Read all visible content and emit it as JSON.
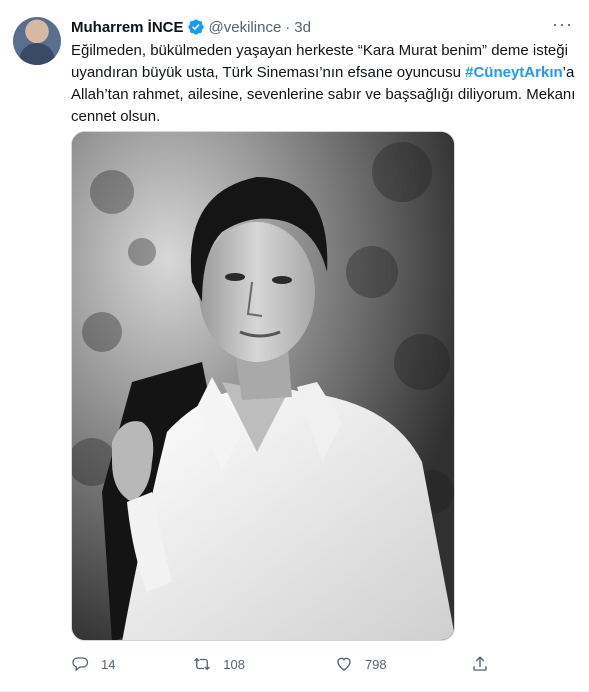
{
  "author": {
    "name": "Muharrem İNCE",
    "handle": "@vekilince",
    "separator": "·",
    "time": "3d",
    "avatar_icon": "profile-avatar",
    "verified_icon": "verified-badge-icon"
  },
  "tweet": {
    "text_before": "Eğilmeden, bükülmeden yaşayan herkeste “Kara Murat benim” deme isteği uyandıran büyük usta, Türk Sineması’nın efsane oyuncusu ",
    "hashtag": "#CüneytArkın",
    "text_after": "’a Allah’tan rahmet, ailesine, sevenlerine sabır ve başsağlığı diliyorum. Mekanı cennet olsun."
  },
  "actions": {
    "reply_count": "14",
    "retweet_count": "108",
    "like_count": "798"
  },
  "menu": {
    "more_label": "···"
  },
  "colors": {
    "accent": "#1d9bf0",
    "text": "#0f1419",
    "muted": "#536471"
  }
}
